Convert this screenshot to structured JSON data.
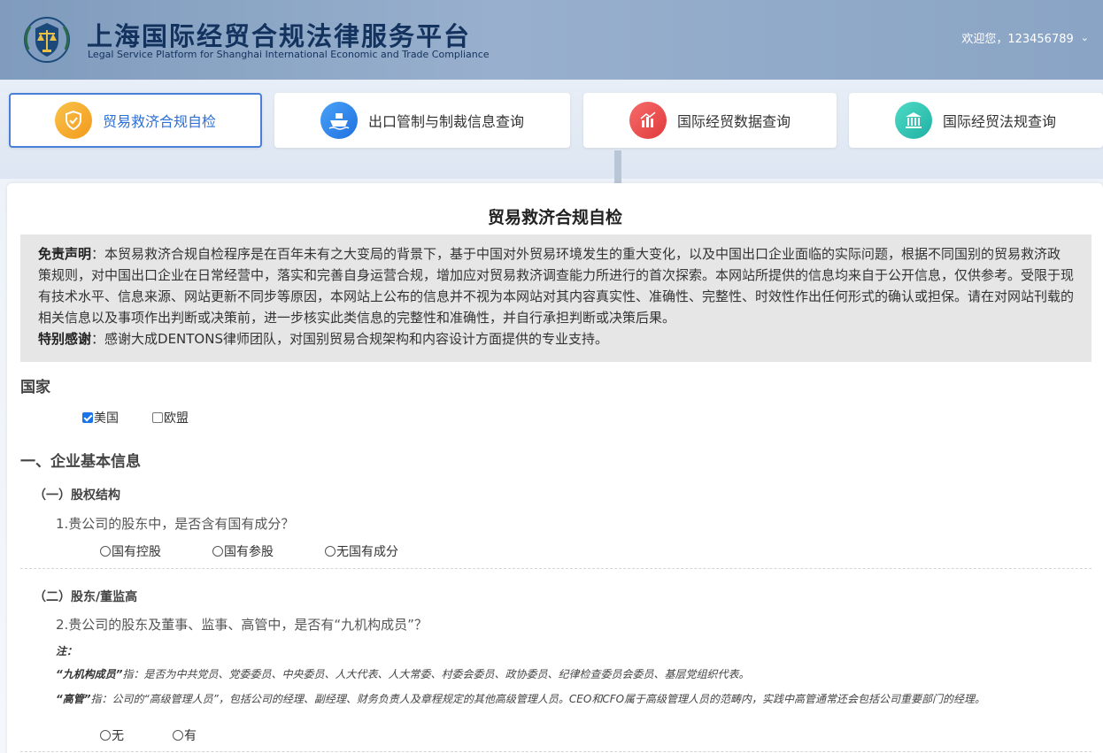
{
  "header": {
    "title_cn": "上海国际经贸合规法律服务平台",
    "title_en": "Legal Service Platform for Shanghai International Economic and Trade Compliance",
    "user_greeting": "欢迎您，123456789"
  },
  "tabs": [
    {
      "label": "贸易救济合规自检",
      "icon": "shield-check-icon",
      "color": "#f5a623",
      "active": true
    },
    {
      "label": "出口管制与制裁信息查询",
      "icon": "ship-icon",
      "color": "#2f8ef0",
      "active": false
    },
    {
      "label": "国际经贸数据查询",
      "icon": "bar-chart-icon",
      "color": "#ef4b4b",
      "active": false
    },
    {
      "label": "国际经贸法规查询",
      "icon": "institution-icon",
      "color": "#2cc6b6",
      "active": false
    }
  ],
  "page": {
    "title": "贸易救济合规自检",
    "disclaimer_label": "免责声明",
    "disclaimer_text": "：本贸易救济合规自检程序是在百年未有之大变局的背景下，基于中国对外贸易环境发生的重大变化，以及中国出口企业面临的实际问题，根据不同国别的贸易救济政策规则，对中国出口企业在日常经营中，落实和完善自身运营合规，增加应对贸易救济调查能力所进行的首次探索。本网站所提供的信息均来自于公开信息，仅供参考。受限于现有技术水平、信息来源、网站更新不同步等原因，本网站上公布的信息并不视为本网站对其内容真实性、准确性、完整性、时效性作出任何形式的确认或担保。请在对网站刊载的相关信息以及事项作出判断或决策前，进一步核实此类信息的完整性和准确性，并自行承担判断或决策后果。",
    "thanks_label": "特别感谢",
    "thanks_text": "：感谢大成DENTONS律师团队，对国别贸易合规架构和内容设计方面提供的专业支持。"
  },
  "country": {
    "label": "国家",
    "options": [
      {
        "label": "美国",
        "checked": true
      },
      {
        "label": "欧盟",
        "checked": false
      }
    ]
  },
  "section1": {
    "title": "一、企业基本信息",
    "sub1": {
      "title": "（一）股权结构",
      "question": "1.贵公司的股东中，是否含有国有成分？",
      "options": [
        "国有控股",
        "国有参股",
        "无国有成分"
      ]
    },
    "sub2": {
      "title": "（二）股东/董监高",
      "question": "2.贵公司的股东及董事、监事、高管中，是否有“九机构成员”？",
      "note_label": "注：",
      "note1_label": "“九机构成员”",
      "note1_text": "指：是否为中共党员、党委委员、中央委员、人大代表、人大常委、村委会委员、政协委员、纪律检查委员会委员、基层党组织代表。",
      "note2_label": "“高管”",
      "note2_text": "指：公司的“高级管理人员”，包括公司的经理、副经理、财务负责人及章程规定的其他高级管理人员。CEO和CFO属于高级管理人员的范畴内，实践中高管通常还会包括公司重要部门的经理。",
      "options": [
        "无",
        "有"
      ]
    }
  }
}
